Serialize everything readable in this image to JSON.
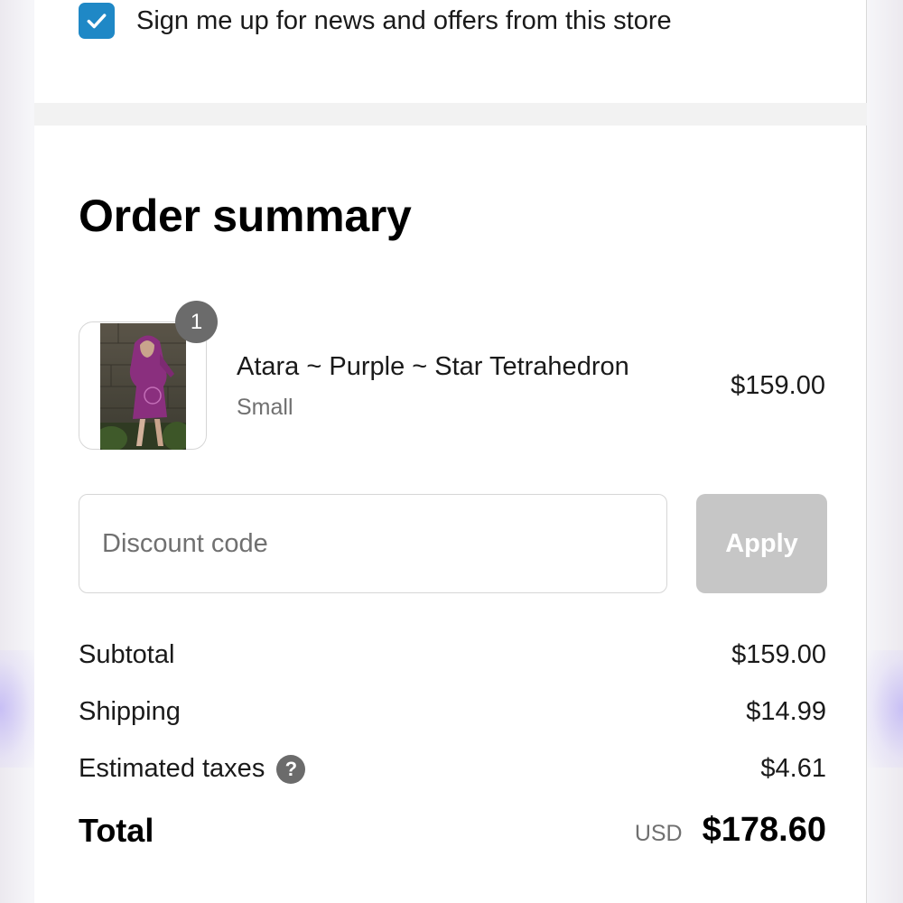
{
  "newsletter": {
    "checked": true,
    "label": "Sign me up for news and offers from this store"
  },
  "order_summary": {
    "title": "Order summary",
    "item": {
      "image_icon": "product-photo",
      "quantity": "1",
      "name": "Atara ~ Purple ~ Star Tetrahedron",
      "variant": "Small",
      "price": "$159.00"
    },
    "discount": {
      "placeholder": "Discount code",
      "value": "",
      "apply_label": "Apply"
    },
    "rows": {
      "subtotal_label": "Subtotal",
      "subtotal_value": "$159.00",
      "shipping_label": "Shipping",
      "shipping_value": "$14.99",
      "taxes_label": "Estimated taxes",
      "taxes_icon": "help-icon",
      "taxes_value": "$4.61"
    },
    "total": {
      "label": "Total",
      "currency": "USD",
      "amount": "$178.60"
    }
  },
  "colors": {
    "checkbox_accent": "#1f88c6",
    "apply_disabled": "#c6c6c6",
    "badge": "#6b6b6b"
  }
}
